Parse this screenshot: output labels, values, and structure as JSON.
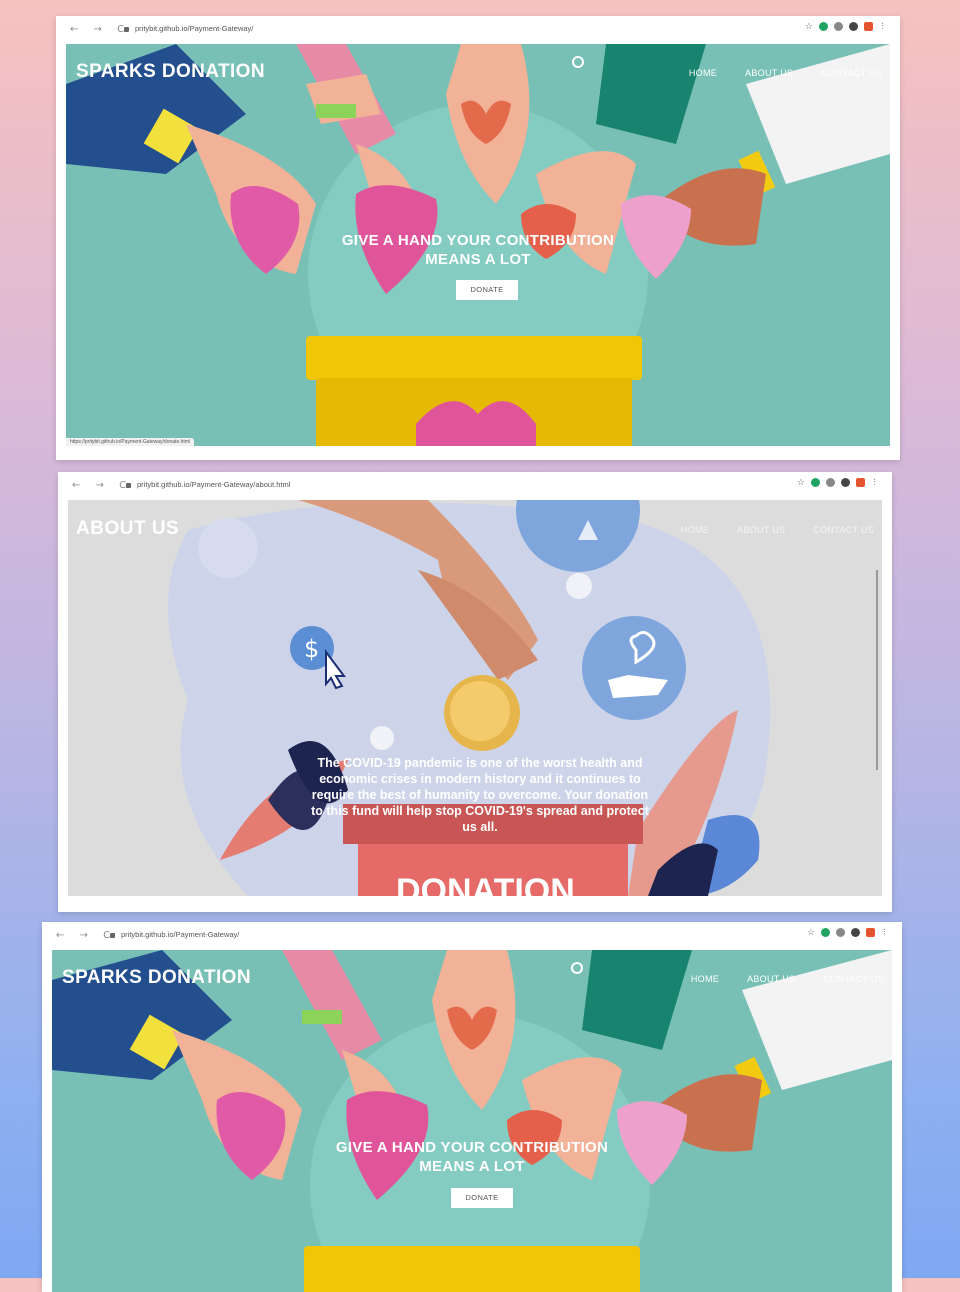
{
  "browser_nav": "← → C",
  "screens": [
    {
      "url": "pritybit.github.io/Payment-Gateway/",
      "brand": "SPARKS DONATION",
      "nav": [
        "HOME",
        "ABOUT US",
        "CONTACT US"
      ],
      "headline_1": "GIVE A HAND YOUR CONTRIBUTION",
      "headline_2": "MEANS A LOT",
      "button": "DONATE",
      "status_bar": "https://pritybit.github.io/Payment-Gateway/donate.html"
    },
    {
      "url": "pritybit.github.io/Payment-Gateway/about.html",
      "title": "ABOUT US",
      "nav": [
        "HOME",
        "ABOUT US",
        "CONTACT US"
      ],
      "body": "The COVID-19 pandemic is one of the worst health and economic crises in modern history and it continues to require the best of humanity to overcome. Your donation to this fund will help stop COVID-19's spread and protect us all.",
      "box_text": "DONATION"
    },
    {
      "url": "pritybit.github.io/Payment-Gateway/",
      "brand": "SPARKS DONATION",
      "nav": [
        "HOME",
        "ABOUT US",
        "CONTACT US"
      ],
      "headline_1": "GIVE A HAND YOUR CONTRIBUTION",
      "headline_2": "MEANS A LOT",
      "button": "DONATE"
    }
  ],
  "icons": [
    "back-arrow-icon",
    "forward-arrow-icon",
    "reload-icon",
    "lock-icon",
    "star-icon",
    "extension-icon",
    "profile-avatar",
    "menu-dots-icon",
    "heart-icon",
    "dollar-icon",
    "cursor-icon",
    "coin-icon"
  ],
  "colors": {
    "teal": "#78c0b6",
    "yellow_box": "#e6b905",
    "pink_heart": "#e0559a",
    "about_bg": "#cdd4ea",
    "red_box": "#e56a68"
  }
}
